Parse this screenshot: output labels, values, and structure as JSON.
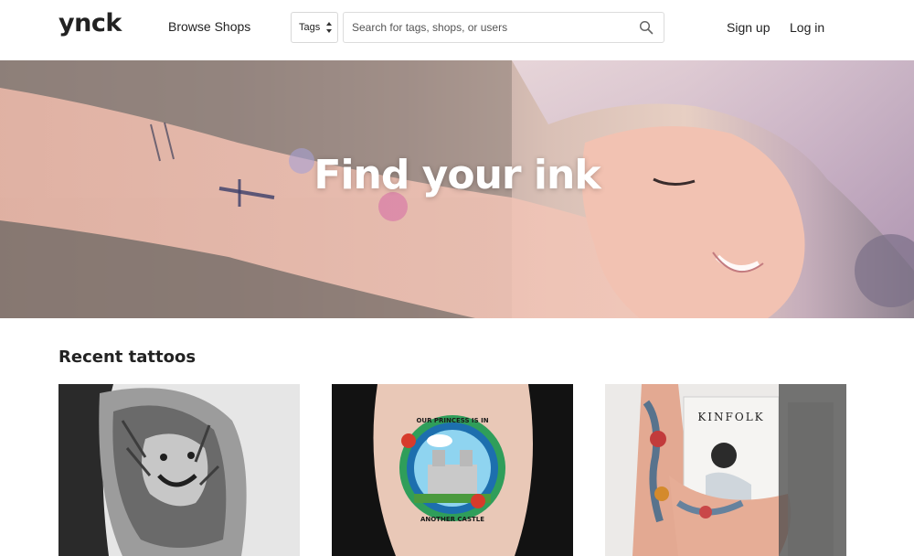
{
  "header": {
    "logo": "ynck",
    "browse_label": "Browse Shops",
    "tags_select": "Tags",
    "search_placeholder": "Search for tags, shops, or users",
    "signup_label": "Sign up",
    "login_label": "Log in"
  },
  "hero": {
    "title": "Find your ink"
  },
  "recent": {
    "title": "Recent tattoos",
    "cards": [
      {
        "subject": "lion"
      },
      {
        "subject": "castle",
        "arc_text_top": "OUR PRINCESS IS IN",
        "arc_text_bottom": "ANOTHER CASTLE"
      },
      {
        "subject": "magazine",
        "magazine_title": "KINFOLK"
      }
    ]
  },
  "colors": {
    "text": "#222222",
    "border": "#dcdcdc",
    "hero_text": "#ffffff"
  },
  "icons": [
    "search-icon",
    "chevron-updown-icon"
  ]
}
